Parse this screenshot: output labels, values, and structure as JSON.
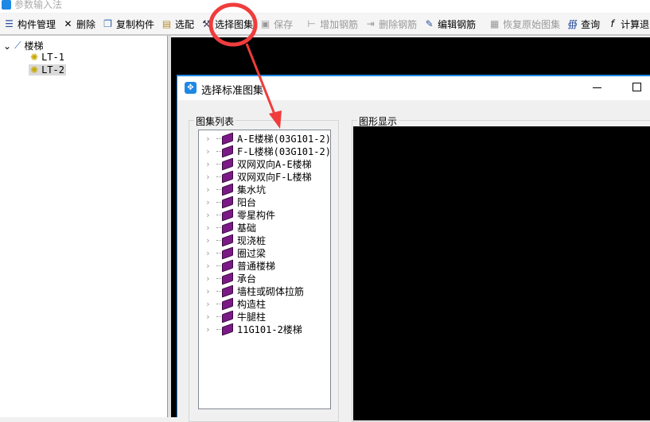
{
  "window": {
    "title": "参数输入法"
  },
  "toolbar": {
    "items": [
      {
        "label": "构件管理",
        "icon": "list-icon",
        "enabled": true
      },
      {
        "label": "删除",
        "icon": "x-icon",
        "enabled": true
      },
      {
        "label": "复制构件",
        "icon": "copy-icon",
        "enabled": true
      },
      {
        "label": "选配",
        "icon": "clipboard-icon",
        "enabled": true
      },
      {
        "label": "选择图集",
        "icon": "atlas-icon",
        "enabled": true
      },
      {
        "label": "保存",
        "icon": "save-icon",
        "enabled": false
      },
      {
        "label": "增加钢筋",
        "icon": "add-rebar-icon",
        "enabled": false
      },
      {
        "label": "删除钢筋",
        "icon": "remove-rebar-icon",
        "enabled": false
      },
      {
        "label": "编辑钢筋",
        "icon": "edit-rebar-icon",
        "enabled": true
      },
      {
        "label": "恢复原始图集",
        "icon": "restore-icon",
        "enabled": false
      },
      {
        "label": "查询",
        "icon": "binoculars-icon",
        "enabled": true
      },
      {
        "label": "计算退出",
        "icon": "fx-icon",
        "enabled": true
      }
    ]
  },
  "tree": {
    "root": "楼梯",
    "children": [
      "LT-1",
      "LT-2"
    ],
    "selected": "LT-2"
  },
  "dialog": {
    "title": "选择标准图集",
    "list_group": "图集列表",
    "preview_group": "图形显示",
    "items": [
      "A-E楼梯(03G101-2)",
      "F-L楼梯(03G101-2)",
      "双网双向A-E楼梯",
      "双网双向F-L楼梯",
      "集水坑",
      "阳台",
      "零星构件",
      "基础",
      "现浇桩",
      "圈过梁",
      "普通楼梯",
      "承台",
      "墙柱或砌体拉筋",
      "构造柱",
      "牛腿柱",
      "11G101-2楼梯"
    ]
  },
  "annotation": {
    "color": "#f03c3c"
  }
}
